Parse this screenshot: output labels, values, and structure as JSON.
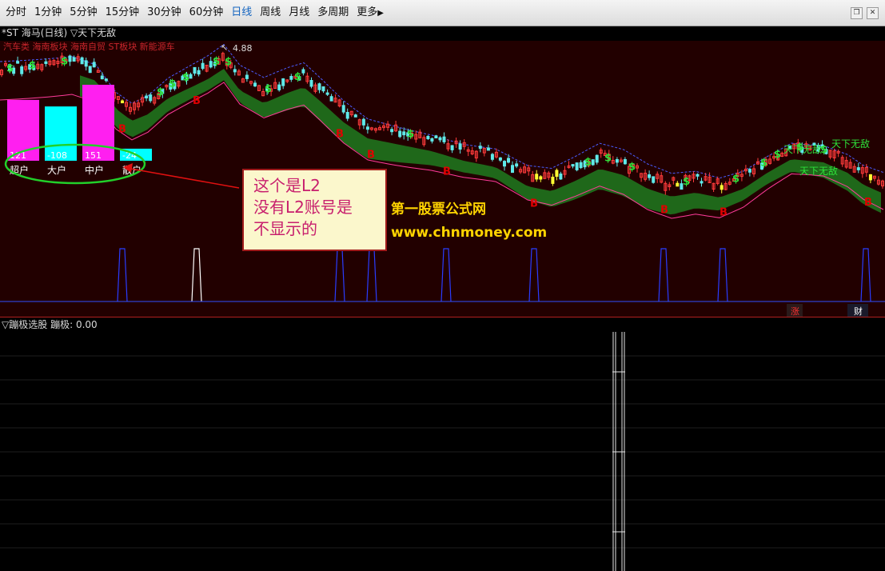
{
  "toolbar": {
    "tabs": [
      {
        "label": "分时",
        "active": false
      },
      {
        "label": "1分钟",
        "active": false
      },
      {
        "label": "5分钟",
        "active": false
      },
      {
        "label": "15分钟",
        "active": false
      },
      {
        "label": "30分钟",
        "active": false
      },
      {
        "label": "60分钟",
        "active": false
      },
      {
        "label": "日线",
        "active": true
      },
      {
        "label": "周线",
        "active": false
      },
      {
        "label": "月线",
        "active": false
      },
      {
        "label": "多周期",
        "active": false
      },
      {
        "label": "更多",
        "active": false
      }
    ],
    "more_icon": "triangle-right-icon",
    "window_icons": [
      "restore-icon",
      "close-icon"
    ]
  },
  "main_chart": {
    "info_line": "*ST 海马(日线) ▽天下无敌",
    "blocks_line": "汽车类 海南板块 海南自贸 ST板块 新能源车",
    "high_price_label": "4.88",
    "buy_marker": "B",
    "sell_marker": "$",
    "wudi_label": "天下无敌",
    "bottom_icons": [
      "涨",
      "财"
    ],
    "colors": {
      "background": "#220000",
      "up_candle": "#ff3b3b",
      "down_candle": "#5fe9e9",
      "yellow_candle": "#ffff33",
      "ribbon": "#1f7a1f",
      "ma_line": "#4a5cff",
      "accent_line": "#ff3b9a",
      "marker_buy": "#e00000",
      "marker_sell": "#2ee03a"
    }
  },
  "l2_panel": {
    "bars": [
      {
        "label": "超户",
        "value": 121,
        "color": "#ff1ff0"
      },
      {
        "label": "大户",
        "value": -108,
        "color": "#00ffff"
      },
      {
        "label": "中户",
        "value": 151,
        "color": "#ff1ff0"
      },
      {
        "label": "散户",
        "value": -24,
        "color": "#00ffff"
      }
    ]
  },
  "annotation": {
    "lines": [
      "这个是L2",
      "没有L2账号是",
      "不显示的"
    ]
  },
  "watermark": {
    "site_name": "第一股票公式网",
    "site_url": "www.chnmoney.com"
  },
  "lower_panel": {
    "title": "▽蹦极选股",
    "indicator_label": "蹦极:",
    "indicator_value": "0.00"
  }
}
